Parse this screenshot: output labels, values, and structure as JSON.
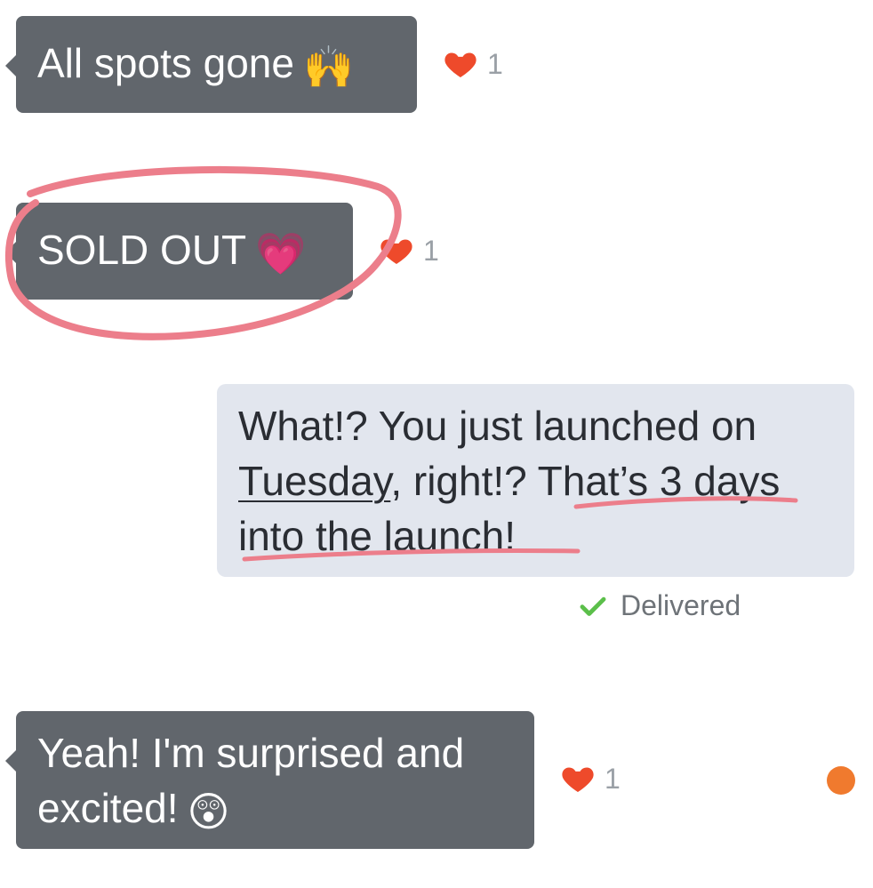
{
  "messages": [
    {
      "text": "All spots gone",
      "emoji": "🙌",
      "reaction_count": "1"
    },
    {
      "text": "SOLD OUT",
      "emoji": "💗",
      "reaction_count": "1"
    },
    {
      "line1": "What!? You just launched on",
      "line2_underlined": "Tuesday",
      "line2_rest": ", right!? That’s 3 days",
      "line3": "into the launch!",
      "status": "Delivered"
    },
    {
      "line1": "Yeah! I'm surprised and",
      "line2": "excited!",
      "emoji": "😲",
      "reaction_count": "1"
    }
  ],
  "colors": {
    "incoming_bubble": "#61666c",
    "outgoing_bubble": "#e2e6ee",
    "reaction_heart": "#ee4a2b",
    "annotation_pink": "#ec7e8b",
    "delivered_check": "#5bbf4a",
    "unread_dot": "#f07a2e"
  },
  "icons": [
    "heart-icon",
    "check-icon",
    "unread-dot"
  ]
}
